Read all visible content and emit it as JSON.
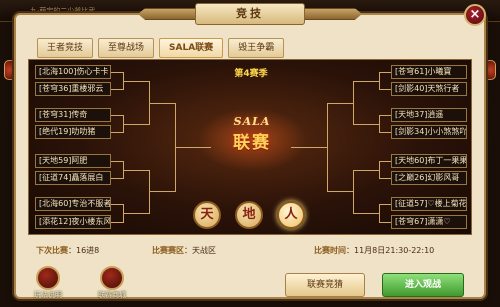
{
  "top_strip_text": "九·萌宝的二少爷比武",
  "title": "竞技",
  "close_label": "×",
  "tabs": [
    {
      "label": "王者竞技",
      "active": false
    },
    {
      "label": "至尊战场",
      "active": false
    },
    {
      "label": "SALA联赛",
      "active": true
    },
    {
      "label": "毁王争霸",
      "active": false
    }
  ],
  "season": "第4赛季",
  "emblem": {
    "sala": "SALA",
    "lian": "联赛"
  },
  "left_players": [
    "[北海100]伤心卡卡",
    "[苍穹36]重楼邪云",
    "[苍穹31]传奇",
    "[绝代19]叻叻猪",
    "[天地59]阿肥",
    "[征道74]矗落展白",
    "[北海60]专治不服者",
    "[添花12]夜小楼东风"
  ],
  "right_players": [
    "[苍穹61]小曦寶",
    "[剑影40]天煞行者",
    "[天地37]逍遥",
    "[剑影34]小小煞煞吖",
    "[天地60]布丁一果果",
    "[之巅26]幻影风哥",
    "[征道57]♡楼上菊花",
    "[苍穹67]潇潇♡"
  ],
  "zones": [
    {
      "label": "天",
      "active": false
    },
    {
      "label": "地",
      "active": false
    },
    {
      "label": "人",
      "active": true
    }
  ],
  "info": {
    "stage_key": "下次比赛",
    "stage_value": "：16进8",
    "zone_key": "比赛赛区",
    "zone_value": "：天战区",
    "time_key": "比赛时间",
    "time_value": "：11月8日21:30-22:10"
  },
  "buttons": {
    "bet": "联赛竞猜",
    "watch": "进入观战"
  },
  "bottom_icons": [
    {
      "label": "玩法说明"
    },
    {
      "label": "联赛商城"
    }
  ]
}
